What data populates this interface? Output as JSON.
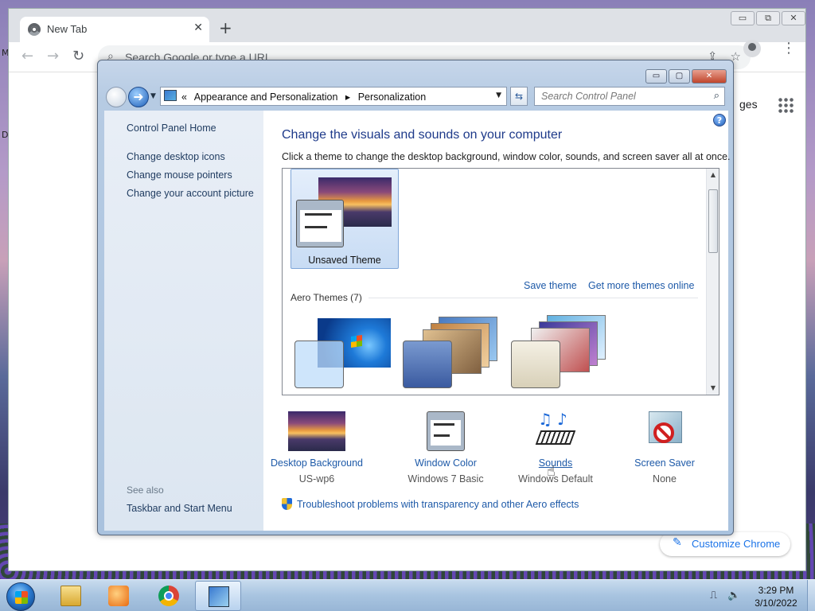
{
  "desktop": {
    "edge_texts": [
      "M",
      "D"
    ]
  },
  "chrome": {
    "tab_title": "New Tab",
    "tab_close": "✕",
    "new_tab": "+",
    "window_controls": [
      "▭",
      "⧉",
      "✕"
    ],
    "back": "←",
    "forward": "→",
    "reload": "↻",
    "omnibox_placeholder": "Search Google or type a URL",
    "images_link": "ges",
    "customize_label": "Customize Chrome",
    "icons": {
      "favicon": "chrome-icon",
      "search": "search-icon",
      "share": "share-icon",
      "bookmark": "star-icon",
      "profile": "profile-icon",
      "menu": "kebab-menu-icon",
      "apps": "apps-grid-icon",
      "customize": "pencil-icon"
    }
  },
  "control_panel": {
    "window_controls": [
      "▭",
      "▢",
      "✕"
    ],
    "breadcrumb_root": "«",
    "breadcrumbs": [
      "Appearance and Personalization",
      "▸",
      "Personalization"
    ],
    "search_placeholder": "Search Control Panel",
    "left_links": [
      "Control Panel Home",
      "Change desktop icons",
      "Change mouse pointers",
      "Change your account picture"
    ],
    "see_also_label": "See also",
    "see_also_link": "Taskbar and Start Menu",
    "heading": "Change the visuals and sounds on your computer",
    "subheading": "Click a theme to change the desktop background, window color, sounds, and screen saver all at once.",
    "my_themes": [
      {
        "name": "Unsaved Theme",
        "selected": true
      }
    ],
    "save_theme": "Save theme",
    "get_more_themes": "Get more themes online",
    "aero_header": "Aero Themes (7)",
    "aero_themes_visible": [
      "windows-7-theme",
      "architecture-theme",
      "characters-theme"
    ],
    "settings": [
      {
        "name": "Desktop Background",
        "value": "US-wp6",
        "icon": "desktop-background-icon"
      },
      {
        "name": "Window Color",
        "value": "Windows 7 Basic",
        "icon": "window-color-icon"
      },
      {
        "name": "Sounds",
        "value": "Windows Default",
        "icon": "sounds-icon"
      },
      {
        "name": "Screen Saver",
        "value": "None",
        "icon": "screen-saver-icon"
      }
    ],
    "troubleshoot": "Troubleshoot problems with transparency and other Aero effects",
    "help": "?"
  },
  "taskbar": {
    "apps": [
      "explorer",
      "media-player",
      "chrome",
      "control-panel"
    ],
    "active_app": "control-panel",
    "time": "3:29 PM",
    "date": "3/10/2022",
    "tray_icons": [
      "network-icon",
      "volume-icon"
    ]
  }
}
